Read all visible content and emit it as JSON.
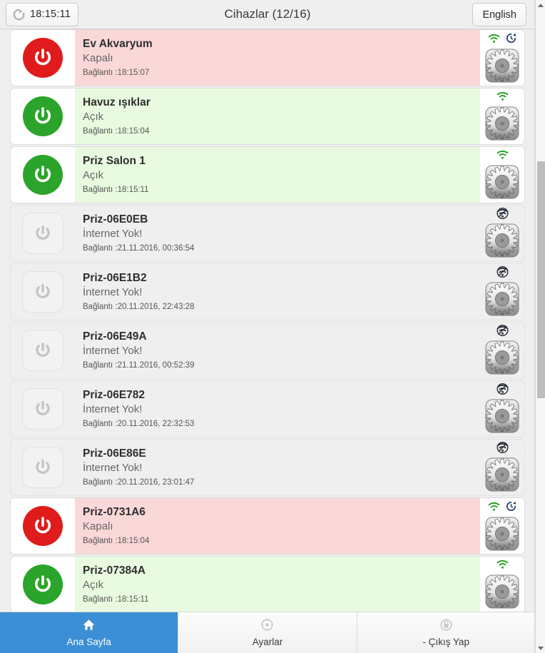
{
  "header": {
    "refresh_icon": "refresh-icon",
    "time": "18:15:11",
    "title": "Cihazlar (12/16)",
    "language_label": "English"
  },
  "labels": {
    "status_on": "Açık",
    "status_off": "Kapalı",
    "status_offline": "İnternet Yok!"
  },
  "devices": [
    {
      "name": "Ev Akvaryum",
      "status": "Kapalı",
      "connection": "Bağlantı :18:15:07",
      "state": "off",
      "online": true,
      "wifi": "wifi-icon",
      "timer": "timer-icon",
      "settings": "gear-icon"
    },
    {
      "name": "Havuz ışıklar",
      "status": "Açık",
      "connection": "Bağlantı :18:15:04",
      "state": "on",
      "online": true,
      "wifi": "wifi-icon",
      "timer": null,
      "settings": "gear-icon"
    },
    {
      "name": "Priz Salon 1",
      "status": "Açık",
      "connection": "Bağlantı :18:15:11",
      "state": "on",
      "online": true,
      "wifi": "wifi-icon",
      "timer": null,
      "settings": "gear-icon"
    },
    {
      "name": "Priz-06E0EB",
      "status": "İnternet Yok!",
      "connection": "Bağlantı :21.11.2016, 00:36:54",
      "state": "idle",
      "online": false,
      "wifi": "wifi-off-icon",
      "timer": null,
      "settings": "gear-icon"
    },
    {
      "name": "Priz-06E1B2",
      "status": "İnternet Yok!",
      "connection": "Bağlantı :20.11.2016, 22:43:28",
      "state": "idle",
      "online": false,
      "wifi": "wifi-off-icon",
      "timer": null,
      "settings": "gear-icon"
    },
    {
      "name": "Priz-06E49A",
      "status": "İnternet Yok!",
      "connection": "Bağlantı :21.11.2016, 00:52:39",
      "state": "idle",
      "online": false,
      "wifi": "wifi-off-icon",
      "timer": null,
      "settings": "gear-icon"
    },
    {
      "name": "Priz-06E782",
      "status": "İnternet Yok!",
      "connection": "Bağlantı :20.11.2016, 22:32:53",
      "state": "idle",
      "online": false,
      "wifi": "wifi-off-icon",
      "timer": null,
      "settings": "gear-icon"
    },
    {
      "name": "Priz-06E86E",
      "status": "İnternet Yok!",
      "connection": "Bağlantı :20.11.2016, 23:01:47",
      "state": "idle",
      "online": false,
      "wifi": "wifi-off-icon",
      "timer": null,
      "settings": "gear-icon"
    },
    {
      "name": "Priz-0731A6",
      "status": "Kapalı",
      "connection": "Bağlantı :18:15:04",
      "state": "off",
      "online": true,
      "wifi": "wifi-icon",
      "timer": "timer-icon",
      "settings": "gear-icon"
    },
    {
      "name": "Priz-07384A",
      "status": "Açık",
      "connection": "Bağlantı :18:15:11",
      "state": "on",
      "online": true,
      "wifi": "wifi-icon",
      "timer": null,
      "settings": "gear-icon"
    }
  ],
  "footer": {
    "items": [
      {
        "label": "Ana Sayfa",
        "icon": "home-icon",
        "active": true
      },
      {
        "label": "Ayarlar",
        "icon": "gear-icon",
        "active": false
      },
      {
        "label": "- Çıkış Yap",
        "icon": "lock-icon",
        "active": false
      }
    ]
  },
  "colors": {
    "accent": "#3b8fd4",
    "on_bg": "#e8fbe0",
    "off_bg": "#fbd8d8",
    "offline_bg": "#efefef",
    "power_on": "#2aa42a",
    "power_off": "#e01b1b",
    "wifi_on": "#2aa42a",
    "timer": "#1b3a63"
  },
  "scrollbar": {
    "orientation": "vertical"
  }
}
